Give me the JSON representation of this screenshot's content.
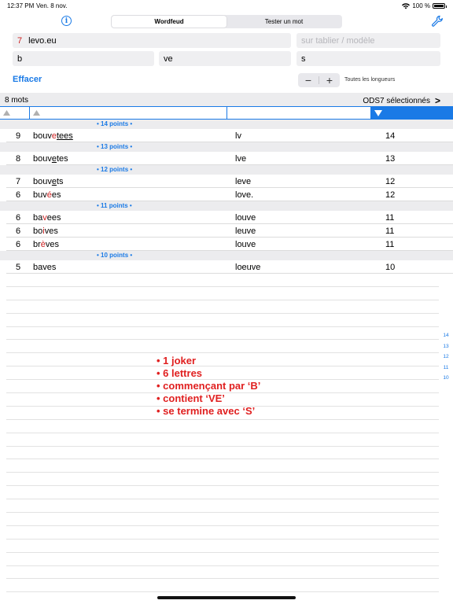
{
  "status": {
    "time": "12:37 PM",
    "date": "Ven. 8 nov.",
    "battery": "100 %"
  },
  "tabs": [
    "Wordfeud",
    "Tester un mot"
  ],
  "form": {
    "rack_count": "7",
    "rack_value": "levo.eu",
    "board_placeholder": "sur tablier / modèle",
    "start_value": "b",
    "contains_value": "ve",
    "end_value": "s"
  },
  "clear_label": "Effacer",
  "stepper": {
    "minus": "−",
    "plus": "+"
  },
  "lengths_label": "Toutes les longueurs",
  "summary": {
    "word_count": "8 mots",
    "dictionary": "ODS7 sélectionnés",
    "chevron": ">"
  },
  "groups": [
    {
      "header": "• 14 points •",
      "rows": [
        {
          "count": "9",
          "word_parts": [
            [
              "bouv",
              ""
            ],
            [
              "e",
              "hl"
            ],
            [
              "tees",
              "ul"
            ]
          ],
          "rest": "lv",
          "points": "14"
        }
      ]
    },
    {
      "header": "• 13 points •",
      "rows": [
        {
          "count": "8",
          "word_parts": [
            [
              "bouv",
              ""
            ],
            [
              "e",
              "ul"
            ],
            [
              "tes",
              ""
            ]
          ],
          "rest": "lve",
          "points": "13"
        }
      ]
    },
    {
      "header": "• 12 points •",
      "rows": [
        {
          "count": "7",
          "word_parts": [
            [
              "bouv",
              ""
            ],
            [
              "e",
              "ul"
            ],
            [
              "ts",
              ""
            ]
          ],
          "rest": "leve",
          "points": "12"
        },
        {
          "count": "6",
          "word_parts": [
            [
              "buv",
              ""
            ],
            [
              "é",
              "hl"
            ],
            [
              "es",
              ""
            ]
          ],
          "rest": "love.",
          "points": "12"
        }
      ]
    },
    {
      "header": "• 11 points •",
      "rows": [
        {
          "count": "6",
          "word_parts": [
            [
              "ba",
              ""
            ],
            [
              "v",
              "hl"
            ],
            [
              "ees",
              ""
            ]
          ],
          "rest": "louve",
          "points": "11"
        },
        {
          "count": "6",
          "word_parts": [
            [
              "bo",
              ""
            ],
            [
              "i",
              "hl"
            ],
            [
              "ves",
              ""
            ]
          ],
          "rest": "leuve",
          "points": "11"
        },
        {
          "count": "6",
          "word_parts": [
            [
              "br",
              ""
            ],
            [
              "è",
              "hl"
            ],
            [
              "ves",
              ""
            ]
          ],
          "rest": "louve",
          "points": "11"
        }
      ]
    },
    {
      "header": "• 10 points •",
      "rows": [
        {
          "count": "5",
          "word_parts": [
            [
              "baves",
              ""
            ]
          ],
          "rest": "loeuve",
          "points": "10"
        }
      ]
    }
  ],
  "index": [
    "14",
    "13",
    "12",
    "11",
    "10"
  ],
  "annotation": [
    "• 1 joker",
    "• 6 lettres",
    "• commençant par ‘B’",
    "• contient ‘VE’",
    "• se termine avec ‘S’"
  ],
  "colors": {
    "accent": "#1a7ae6",
    "highlight": "#cc2020",
    "annotation": "#e02020"
  }
}
